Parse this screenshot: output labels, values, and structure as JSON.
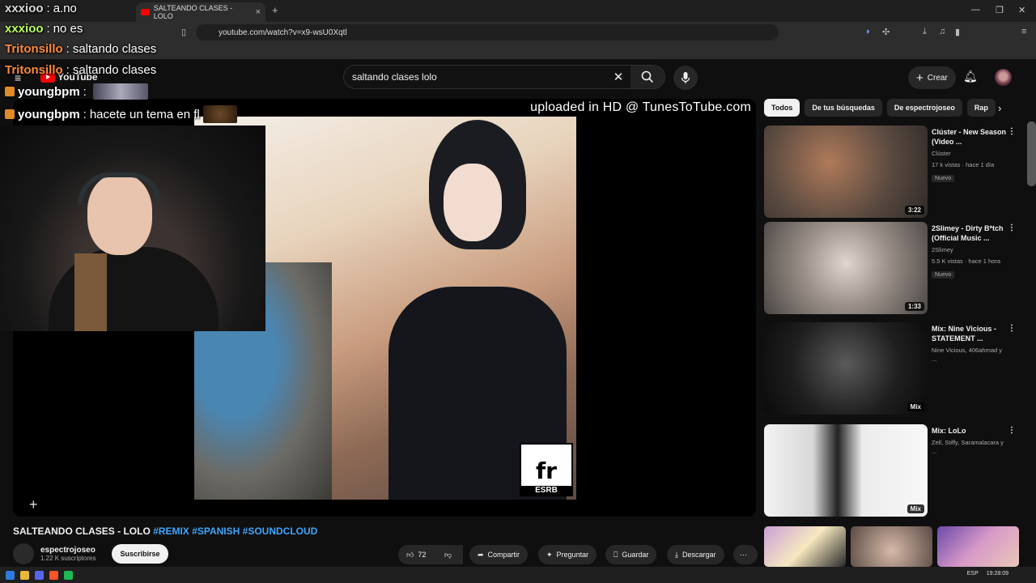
{
  "browser": {
    "tab_title": "SALTEANDO CLASES - LOLO",
    "url": "youtube.com/watch?v=x9-wsU0Xqtl"
  },
  "youtube": {
    "logo_text": "YouTube",
    "search_value": "saltando clases lolo",
    "create_label": "Crear"
  },
  "player": {
    "uploaded_text": "uploaded in HD @ TunesToTube.com",
    "esrb_rating": "fr",
    "esrb_label": "ESRB"
  },
  "chat": [
    {
      "user": "xxxioo",
      "message": "a.no"
    },
    {
      "user": "xxxioo",
      "message": "no es"
    },
    {
      "user": "Tritonsillo",
      "message": "saltando clases"
    },
    {
      "user": "Tritonsillo",
      "message": "saltando clases"
    },
    {
      "user": "youngbpm",
      "message": ""
    },
    {
      "user": "youngbpm",
      "message": "hacete un tema en fl"
    }
  ],
  "video": {
    "title": "SALTEANDO CLASES - LOLO",
    "hashtags": [
      "#REMIX",
      "#SPANISH",
      "#SOUNDCLOUD"
    ],
    "channel_name": "espectrojoseo",
    "subscribers": "1.22 K suscriptores",
    "subscribe_label": "Suscribirse",
    "likes": "72",
    "share_label": "Compartir",
    "ask_label": "Preguntar",
    "save_label": "Guardar",
    "download_label": "Descargar"
  },
  "chips": [
    "Todos",
    "De tus búsquedas",
    "De espectrojoseo",
    "Rap"
  ],
  "recommendations": [
    {
      "title": "Clúster - New Season (Video ...",
      "channel": "Clúster",
      "meta": "17 k vistas · hace 1 día",
      "badge": "Nuevo",
      "duration": "3:22"
    },
    {
      "title": "2Slimey - Dirty B*tch (Official Music ...",
      "channel": "2Slimey",
      "meta": "5.5 K vistas · hace 1 hora",
      "badge": "Nuevo",
      "duration": "1:33"
    },
    {
      "title": "Mix: Nine Vicious - STATEMENT ...",
      "channel": "Nine Vicious, 406ahmad y ...",
      "meta": "",
      "badge": "",
      "duration": "Mix"
    },
    {
      "title": "Mix: LoLo",
      "channel": "Zell, Stiffy, Saramalacara y ...",
      "meta": "",
      "badge": "",
      "duration": "Mix"
    }
  ],
  "taskbar": {
    "lang": "ESP",
    "time": "19:28:09"
  },
  "colors": {
    "accent": "#3ea6ff",
    "brand": "#ff0000",
    "background": "#0f0f0f"
  }
}
